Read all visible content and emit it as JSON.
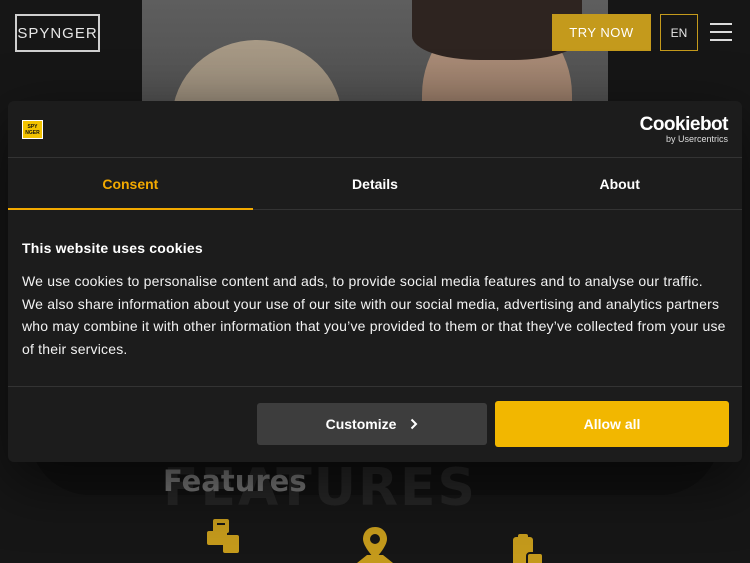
{
  "header": {
    "logo_text": "SPYNGER",
    "try_label": "TRY NOW",
    "lang_label": "EN"
  },
  "features": {
    "ghost_text": "FEATURES",
    "title": "Features",
    "icons": [
      "puzzle-phone-icon",
      "map-pin-icon",
      "clipboard-phone-icon"
    ]
  },
  "cookie": {
    "brand_logo_top": "SPY",
    "brand_logo_bottom": "NGER",
    "provider_name": "Cookiebot",
    "provider_sub": "by Usercentrics",
    "tabs": [
      "Consent",
      "Details",
      "About"
    ],
    "heading": "This website uses cookies",
    "body": "We use cookies to personalise content and ads, to provide social media features and to analyse our traffic. We also share information about your use of our site with our social media, advertising and analytics partners who may combine it with other information that you’ve provided to them or that they’ve collected from your use of their services.",
    "customize_label": "Customize",
    "allow_label": "Allow all"
  },
  "colors": {
    "accent": "#f2b700",
    "tab_active": "#f2a900",
    "try_button": "#c49a1c",
    "dialog_bg": "#1c1c1c"
  }
}
